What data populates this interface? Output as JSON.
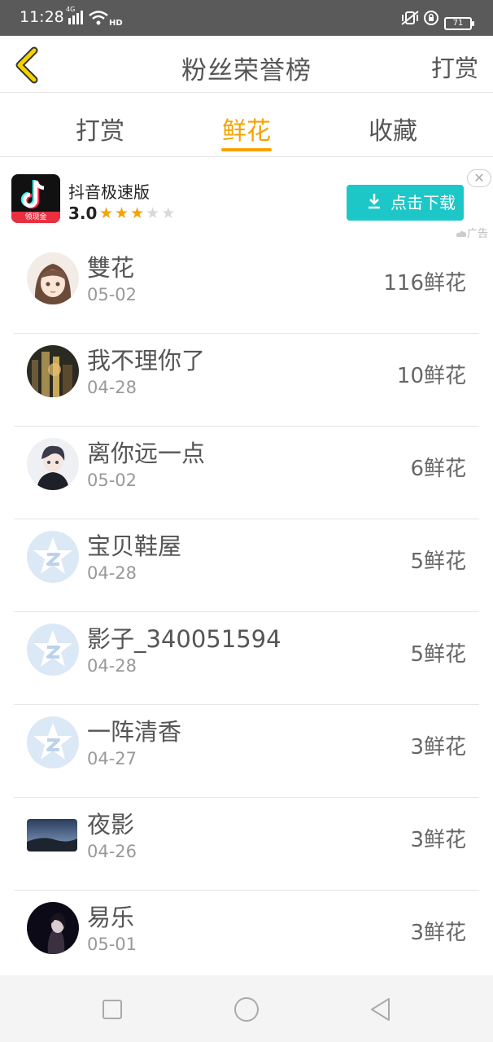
{
  "status_bar": {
    "time": "11:28",
    "network_type": "4G",
    "hd_label": "HD",
    "battery": "71"
  },
  "header": {
    "title": "粉丝荣誉榜",
    "action_label": "打赏",
    "accent_color": "#f5a300"
  },
  "tabs": [
    {
      "label": "打赏",
      "active": false
    },
    {
      "label": "鲜花",
      "active": true
    },
    {
      "label": "收藏",
      "active": false
    }
  ],
  "ad": {
    "app_name": "抖音极速版",
    "rating": "3.0",
    "stars": 3,
    "stars_total": 5,
    "button_label": "点击下载",
    "ad_label": "广告",
    "icon_ribbon": "领现金",
    "button_color": "#1ec7c7"
  },
  "fans": [
    {
      "name": "雙花",
      "date": "05-02",
      "count": "116鲜花",
      "avatar": "anime-girl-avatar"
    },
    {
      "name": "我不理你了",
      "date": "04-28",
      "count": "10鲜花",
      "avatar": "city-night-avatar"
    },
    {
      "name": "离你远一点",
      "date": "05-02",
      "count": "6鲜花",
      "avatar": "anime-boy-avatar"
    },
    {
      "name": "宝贝鞋屋",
      "date": "04-28",
      "count": "5鲜花",
      "avatar": "default-qq-avatar"
    },
    {
      "name": "影子_340051594",
      "date": "04-28",
      "count": "5鲜花",
      "avatar": "default-qq-avatar"
    },
    {
      "name": "一阵清香",
      "date": "04-27",
      "count": "3鲜花",
      "avatar": "default-qq-avatar"
    },
    {
      "name": "夜影",
      "date": "04-26",
      "count": "3鲜花",
      "avatar": "landscape-avatar"
    },
    {
      "name": "易乐",
      "date": "05-01",
      "count": "3鲜花",
      "avatar": "dark-portrait-avatar"
    }
  ]
}
